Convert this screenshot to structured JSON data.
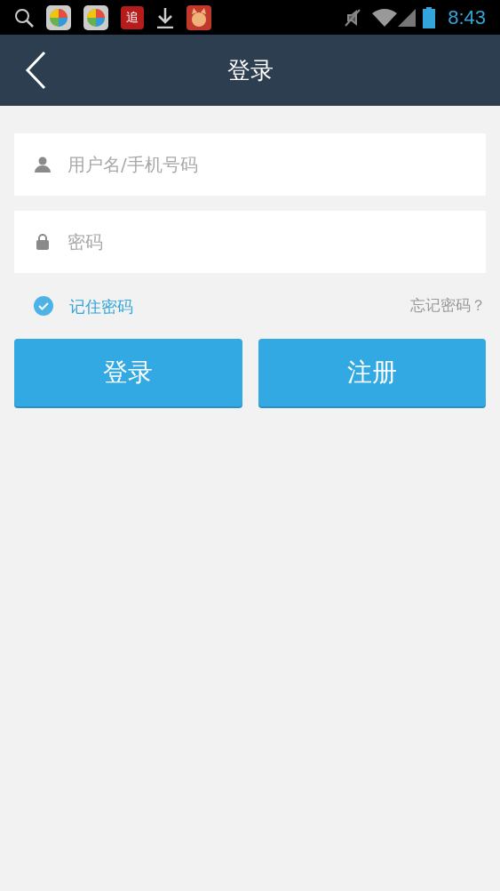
{
  "status_bar": {
    "notification_icons": [
      {
        "kind": "search"
      },
      {
        "kind": "ball"
      },
      {
        "kind": "ball"
      },
      {
        "kind": "badge",
        "label": "追"
      },
      {
        "kind": "download"
      },
      {
        "kind": "cat"
      }
    ],
    "time": "8:43"
  },
  "header": {
    "title": "登录"
  },
  "form": {
    "username": {
      "placeholder": "用户名/手机号码"
    },
    "password": {
      "placeholder": "密码"
    },
    "remember": {
      "label": "记住密码",
      "checked": true
    },
    "forgot_link": "忘记密码？",
    "buttons": [
      "登录",
      "注册"
    ]
  }
}
